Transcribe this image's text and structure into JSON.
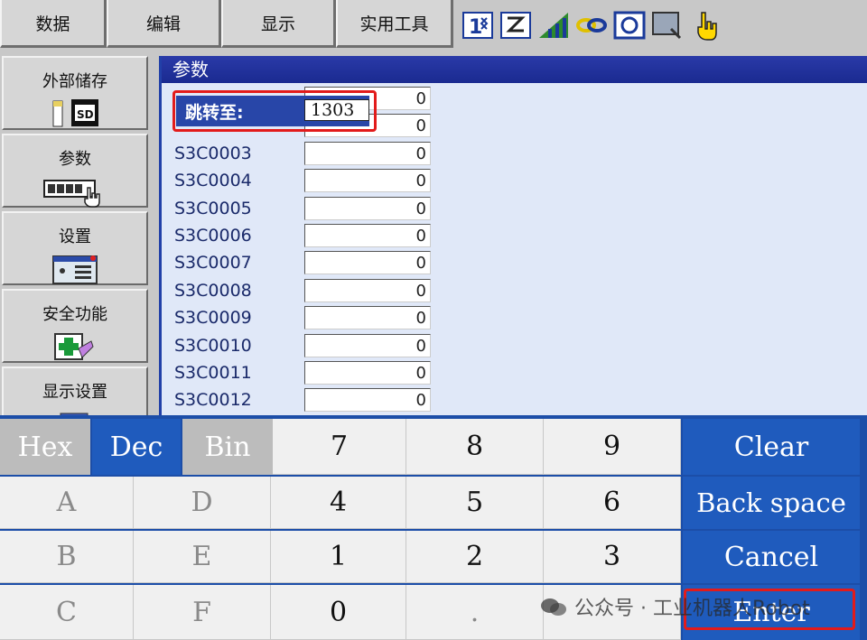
{
  "menu": [
    "数据",
    "编辑",
    "显示",
    "实用工具"
  ],
  "toolbar_icons": [
    "numeric-toggle-icon",
    "edit-frame-icon",
    "signal-icon",
    "chain-icon",
    "screen-icon",
    "cursor-box-icon",
    "hand-pointer-icon"
  ],
  "toolbar_icon_glyphs": [
    "1⇅",
    "Z",
    "◢",
    "⛓",
    "◙",
    "▭",
    "☝"
  ],
  "sidebar": [
    {
      "label": "外部储存",
      "icon": "sd-card-icon"
    },
    {
      "label": "参数",
      "icon": "parameter-hand-icon"
    },
    {
      "label": "设置",
      "icon": "setup-panel-icon"
    },
    {
      "label": "安全功能",
      "icon": "safety-cross-icon"
    },
    {
      "label": "显示设置",
      "icon": "display-setting-icon"
    }
  ],
  "param_panel": {
    "title": "参数",
    "rows": [
      {
        "name": "",
        "value": "0"
      },
      {
        "name": "",
        "value": "0"
      },
      {
        "name": "S3C0003",
        "value": "0"
      },
      {
        "name": "S3C0004",
        "value": "0"
      },
      {
        "name": "S3C0005",
        "value": "0"
      },
      {
        "name": "S3C0006",
        "value": "0"
      },
      {
        "name": "S3C0007",
        "value": "0"
      },
      {
        "name": "S3C0008",
        "value": "0"
      },
      {
        "name": "S3C0009",
        "value": "0"
      },
      {
        "name": "S3C0010",
        "value": "0"
      },
      {
        "name": "S3C0011",
        "value": "0"
      },
      {
        "name": "S3C0012",
        "value": "0"
      }
    ]
  },
  "goto_dialog": {
    "label": "跳转至:",
    "value": "1303"
  },
  "keypad": {
    "row1": [
      "Hex",
      "Dec",
      "Bin",
      "7",
      "8",
      "9",
      "Clear"
    ],
    "row2": [
      "A",
      "D",
      "4",
      "5",
      "6",
      "Back space"
    ],
    "row3": [
      "B",
      "E",
      "1",
      "2",
      "3",
      "Cancel"
    ],
    "row4": [
      "C",
      "F",
      "0",
      ".",
      "",
      "Enter"
    ]
  },
  "watermark": "公众号 · 工业机器人Robot",
  "colors": {
    "header_blue": "#2a3aa8",
    "accent_blue": "#1f5bbd",
    "highlight_red": "#e21b1b"
  }
}
